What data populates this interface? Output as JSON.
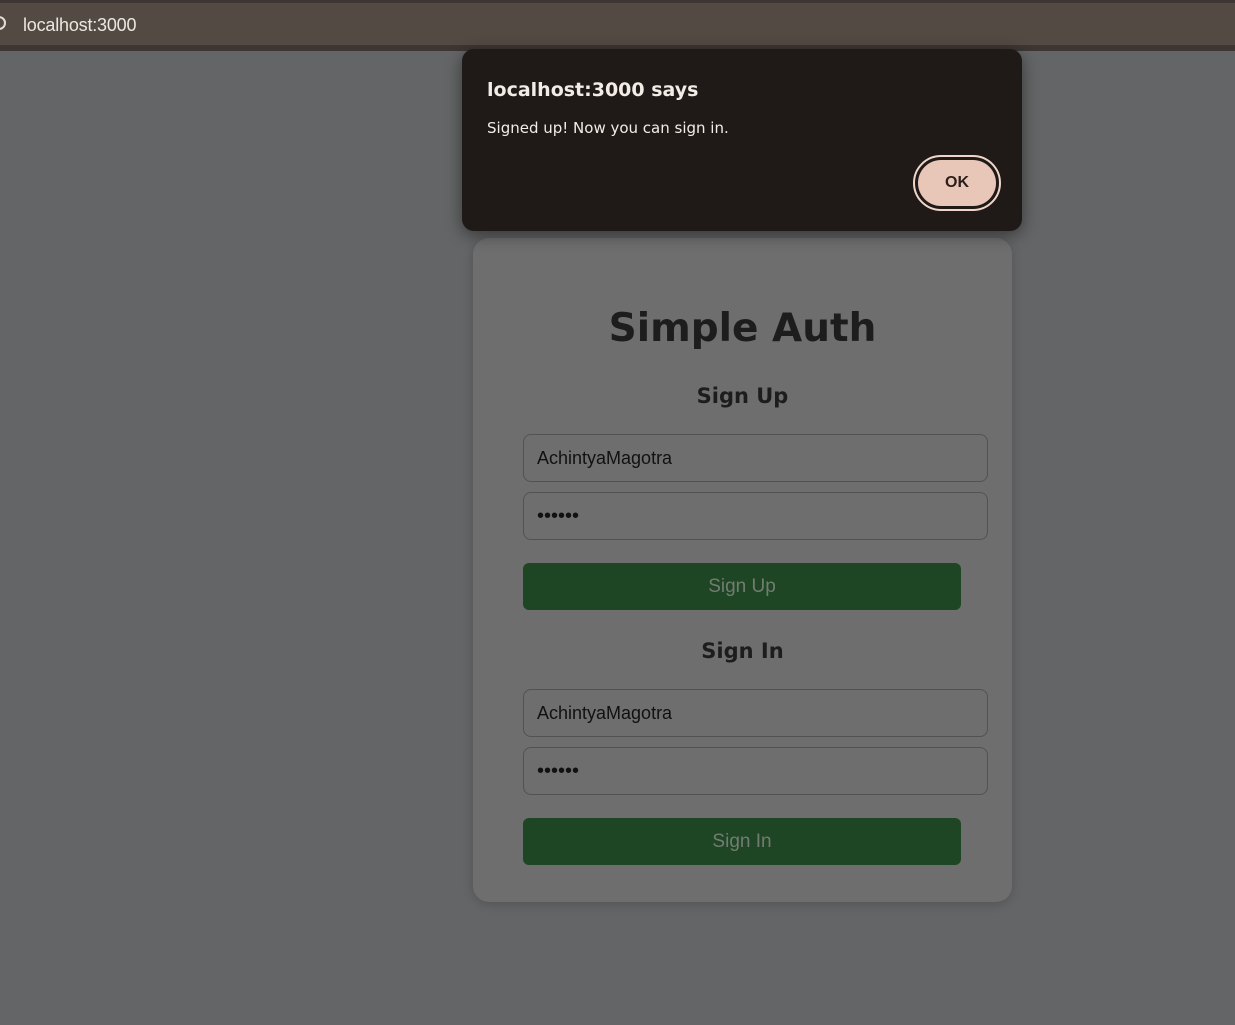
{
  "browser": {
    "url": "localhost:3000"
  },
  "card": {
    "title": "Simple Auth",
    "signup": {
      "heading": "Sign Up",
      "username": "AchintyaMagotra",
      "password": "••••••",
      "button": "Sign Up"
    },
    "signin": {
      "heading": "Sign In",
      "username": "AchintyaMagotra",
      "password": "••••••",
      "button": "Sign In"
    }
  },
  "dialog": {
    "title": "localhost:3000 says",
    "message": "Signed up! Now you can sign in.",
    "ok_label": "OK"
  },
  "colors": {
    "button_green": "#1f4624",
    "dialog_bg": "#1f1a17",
    "ok_button": "#e8c7b8"
  }
}
